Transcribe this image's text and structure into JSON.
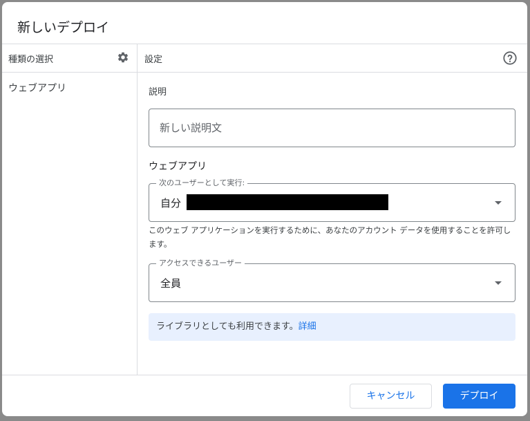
{
  "dialog": {
    "title": "新しいデプロイ"
  },
  "left_panel": {
    "header": "種類の選択",
    "settings_icon": "gear-icon",
    "items": [
      {
        "label": "ウェブアプリ"
      }
    ]
  },
  "right_panel": {
    "header": "設定",
    "help_icon": "help-circle-icon",
    "description": {
      "label": "説明",
      "placeholder": "新しい説明文",
      "value": ""
    },
    "webapp_section": {
      "title": "ウェブアプリ",
      "execute_as": {
        "legend": "次のユーザーとして実行:",
        "value": "自分"
      },
      "execute_help": "このウェブ アプリケーションを実行するために、あなたのアカウント データを使用することを許可します。",
      "access": {
        "legend": "アクセスできるユーザー",
        "value": "全員"
      }
    },
    "info": {
      "text": "ライブラリとしても利用できます。",
      "link": "詳細"
    }
  },
  "footer": {
    "cancel_label": "キャンセル",
    "deploy_label": "デプロイ"
  },
  "colors": {
    "accent": "#1a73e8",
    "info_bg": "#e8f0fe",
    "border": "#dadce0"
  }
}
